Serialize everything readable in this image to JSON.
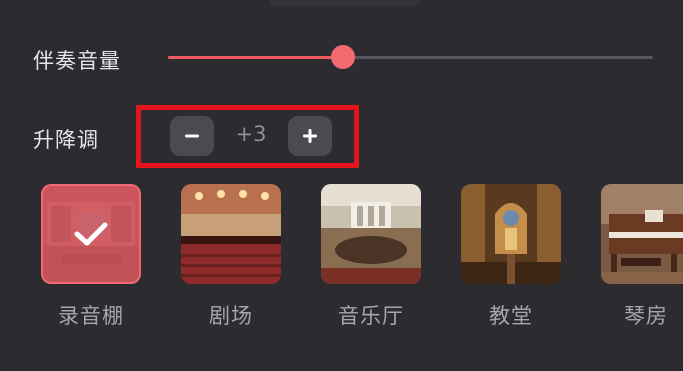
{
  "accompaniment": {
    "label": "伴奏音量",
    "volume_percent": 36
  },
  "pitch": {
    "label": "升降调",
    "value": "+3"
  },
  "scenes": [
    {
      "label": "录音棚",
      "selected": true
    },
    {
      "label": "剧场",
      "selected": false
    },
    {
      "label": "音乐厅",
      "selected": false
    },
    {
      "label": "教堂",
      "selected": false
    },
    {
      "label": "琴房",
      "selected": false
    }
  ],
  "colors": {
    "accent": "#f26970",
    "highlight": "#e3141c",
    "panel": "#2b2b30"
  },
  "icons": {
    "decrease": "minus-icon",
    "increase": "plus-icon",
    "selected": "checkmark-icon"
  }
}
